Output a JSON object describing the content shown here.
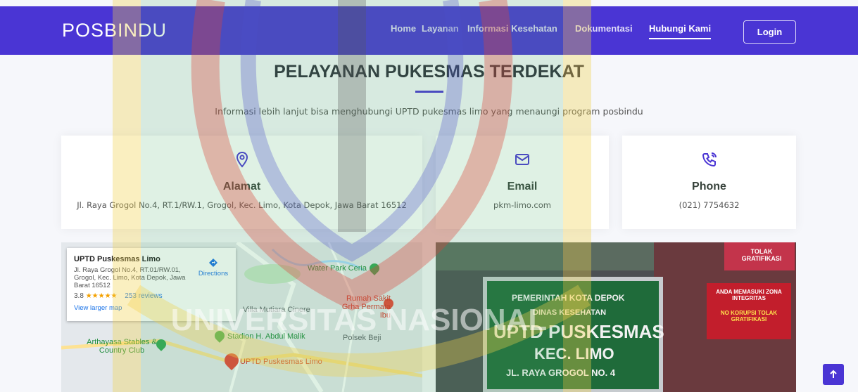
{
  "header": {
    "brand": "POSBINDU",
    "nav": [
      {
        "label": "Home"
      },
      {
        "label": "Layanan"
      },
      {
        "label": "Informasi Kesehatan"
      },
      {
        "label": "Dokumentasi"
      },
      {
        "label": "Hubungi Kami"
      }
    ],
    "login_label": "Login"
  },
  "section": {
    "title": "PELAYANAN PUKESMAS TERDEKAT",
    "subtitle": "Informasi lebih lanjut bisa menghubungi UPTD pukesmas limo yang menaungi program posbindu"
  },
  "cards": [
    {
      "label": "Alamat",
      "value": "Jl. Raya Grogol No.4, RT.1/RW.1, Grogol, Kec. Limo, Kota Depok, Jawa Barat 16512",
      "icon": "map-pin-icon"
    },
    {
      "label": "Email",
      "value": "pkm-limo.com",
      "icon": "envelope-icon"
    },
    {
      "label": "Phone",
      "value": "(021) 7754632",
      "icon": "phone-icon"
    }
  ],
  "map": {
    "place_name": "UPTD Puskesmas Limo",
    "address": "Jl. Raya Grogol No.4, RT.01/RW.01, Grogol, Kec. Limo, Kota Depok, Jawa Barat 16512",
    "rating": "3.8",
    "stars": "★★★★★",
    "reviews": "253 reviews",
    "view_larger": "View larger map",
    "directions": "Directions",
    "labels": {
      "water_park": "Water Park Ceria",
      "rumah_sakit": "Rumah Sakit Grha Permata Ibu",
      "villa": "Villa Mutiara Cinere",
      "stadion": "Stadion H. Abdul Malik",
      "polsek": "Polsek Beji",
      "arthayasa": "Arthayasa Stables & Country Club",
      "uptd": "UPTD Puskesmas Limo"
    }
  },
  "photo": {
    "sign_line1": "PEMERINTAH KOTA DEPOK",
    "sign_line2": "DINAS KESEHATAN",
    "sign_line3": "UPTD PUSKESMAS",
    "sign_line4": "KEC. LIMO",
    "sign_line5": "JL. RAYA GROGOL NO. 4",
    "banner1": "ANDA MEMASUKI ZONA INTEGRITAS",
    "banner2": "NO KORUPSI TOLAK GRATIFIKASI",
    "banner3": "TOLAK GRATIFIKASI"
  },
  "scroll_top_icon": "arrow-up-icon",
  "watermark_text": "UNIVERSITAS NASIONAL",
  "colors": {
    "primary": "#4a35d4",
    "background": "#f6f7fb"
  }
}
